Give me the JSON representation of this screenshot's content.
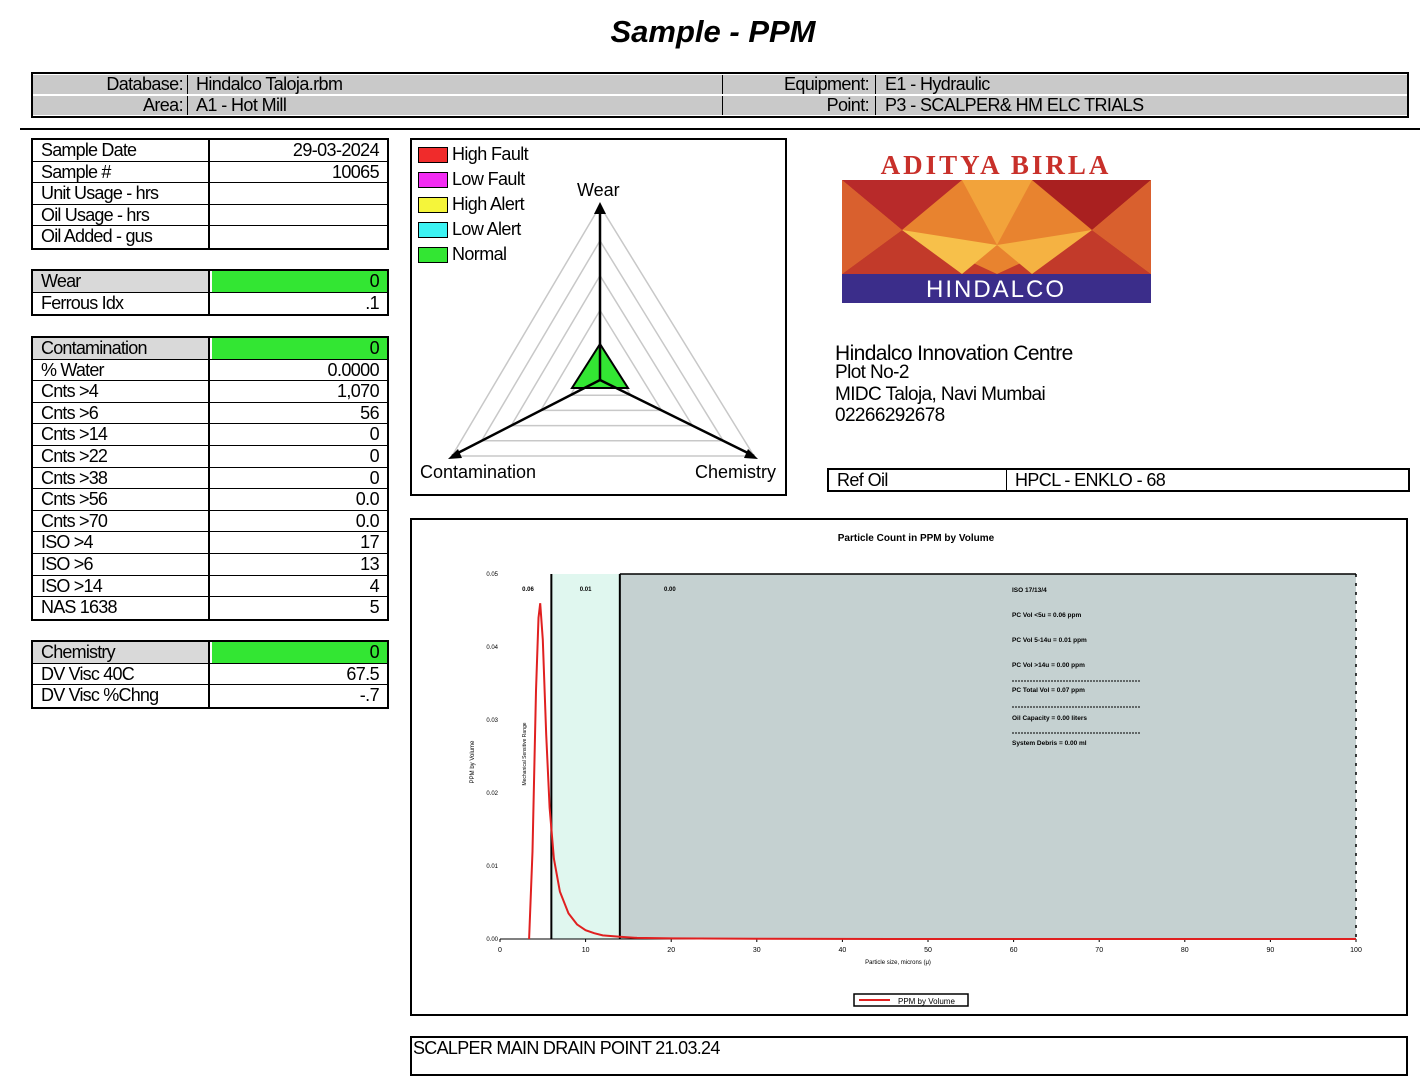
{
  "title": "Sample - PPM",
  "header": {
    "database_label": "Database:",
    "database_value": "Hindalco Taloja.rbm",
    "area_label": "Area:",
    "area_value": "A1 - Hot Mill",
    "equipment_label": "Equipment:",
    "equipment_value": "E1 - Hydraulic",
    "point_label": "Point:",
    "point_value": "P3 - SCALPER& HM ELC TRIALS"
  },
  "sample": [
    {
      "label": "Sample Date",
      "value": "29-03-2024"
    },
    {
      "label": "Sample #",
      "value": "10065"
    },
    {
      "label": "Unit Usage - hrs",
      "value": ""
    },
    {
      "label": "Oil Usage - hrs",
      "value": ""
    },
    {
      "label": "Oil Added - gus",
      "value": ""
    }
  ],
  "wear": [
    {
      "label": "Wear",
      "value": "0"
    },
    {
      "label": "Ferrous Idx",
      "value": ".1"
    }
  ],
  "contamination": [
    {
      "label": "Contamination",
      "value": "0"
    },
    {
      "label": "% Water",
      "value": "0.0000"
    },
    {
      "label": "Cnts >4",
      "value": "1,070"
    },
    {
      "label": "Cnts >6",
      "value": "56"
    },
    {
      "label": "Cnts >14",
      "value": "0"
    },
    {
      "label": "Cnts >22",
      "value": "0"
    },
    {
      "label": "Cnts >38",
      "value": "0"
    },
    {
      "label": "Cnts >56",
      "value": "0.0"
    },
    {
      "label": "Cnts >70",
      "value": "0.0"
    },
    {
      "label": "ISO >4",
      "value": "17"
    },
    {
      "label": "ISO >6",
      "value": "13"
    },
    {
      "label": "ISO >14",
      "value": "4"
    },
    {
      "label": "NAS 1638",
      "value": "5"
    }
  ],
  "chemistry": [
    {
      "label": "Chemistry",
      "value": "0"
    },
    {
      "label": "DV Visc 40C",
      "value": "67.5"
    },
    {
      "label": "DV Visc %Chng",
      "value": "-.7"
    }
  ],
  "legend": [
    {
      "label": "High Fault",
      "color": "#f02b2b"
    },
    {
      "label": "Low Fault",
      "color": "#f22bf2"
    },
    {
      "label": "High Alert",
      "color": "#f5f53a"
    },
    {
      "label": "Low Alert",
      "color": "#3cf2f2"
    },
    {
      "label": "Normal",
      "color": "#33e633"
    }
  ],
  "radar": {
    "axis_top": "Wear",
    "axis_left": "Contamination",
    "axis_right": "Chemistry",
    "normal_color": "#33e633"
  },
  "logo": {
    "brand": "ADITYA BIRLA",
    "name": "HINDALCO"
  },
  "lab": {
    "name": "Hindalco Innovation Centre",
    "line1": "Plot No-2",
    "line2": "MIDC Taloja, Navi Mumbai",
    "phone": "02266292678"
  },
  "ref_oil": {
    "label": "Ref Oil",
    "value": "HPCL - ENKLO - 68"
  },
  "chart_data": {
    "type": "line",
    "title": "Particle Count in PPM by Volume",
    "xlabel": "Particle size, microns (μ)",
    "ylabel": "PPM by Volume",
    "x_ticks": [
      "0",
      "10",
      "20",
      "30",
      "40",
      "50",
      "60",
      "70",
      "80",
      "90",
      "100"
    ],
    "y_ticks": [
      "0.00",
      "0.01",
      "0.02",
      "0.03",
      "0.04",
      "0.05"
    ],
    "xlim": [
      0,
      100
    ],
    "ylim": [
      0,
      0.05
    ],
    "band_bounds": [
      6,
      14
    ],
    "band_labels": [
      "0.06",
      "0.01",
      "0.00"
    ],
    "series": [
      {
        "name": "PPM by Volume",
        "color": "#e02020",
        "x": [
          3.4,
          3.8,
          4.2,
          4.5,
          4.7,
          5.0,
          5.4,
          5.8,
          6.3,
          7.0,
          8.0,
          9.0,
          10.0,
          11.0,
          12.0,
          14.0,
          16.0,
          20.0,
          30.0,
          50.0,
          100.0
        ],
        "y": [
          0.0,
          0.012,
          0.034,
          0.044,
          0.046,
          0.041,
          0.028,
          0.018,
          0.011,
          0.0065,
          0.0035,
          0.002,
          0.0012,
          0.0008,
          0.0005,
          0.0003,
          0.00015,
          8e-05,
          3e-05,
          0.0,
          0.0
        ]
      }
    ],
    "annotations": [
      "ISO 17/13/4",
      "PC Vol <5u   =   0.06 ppm",
      "PC Vol 5-14u   =   0.01 ppm",
      "PC Vol >14u   =   0.00 ppm",
      "PC Total Vol   =   0.07 ppm",
      "Oil Capacity   =   0.00 liters",
      "System Debris  =   0.00 ml"
    ],
    "vertical_label": "Mechanical Sensitive Range",
    "colors": {
      "plot_bg": "#c5d1d1",
      "band_bg": "#e0f7ef"
    }
  },
  "comment": "SCALPER MAIN DRAIN POINT 21.03.24"
}
